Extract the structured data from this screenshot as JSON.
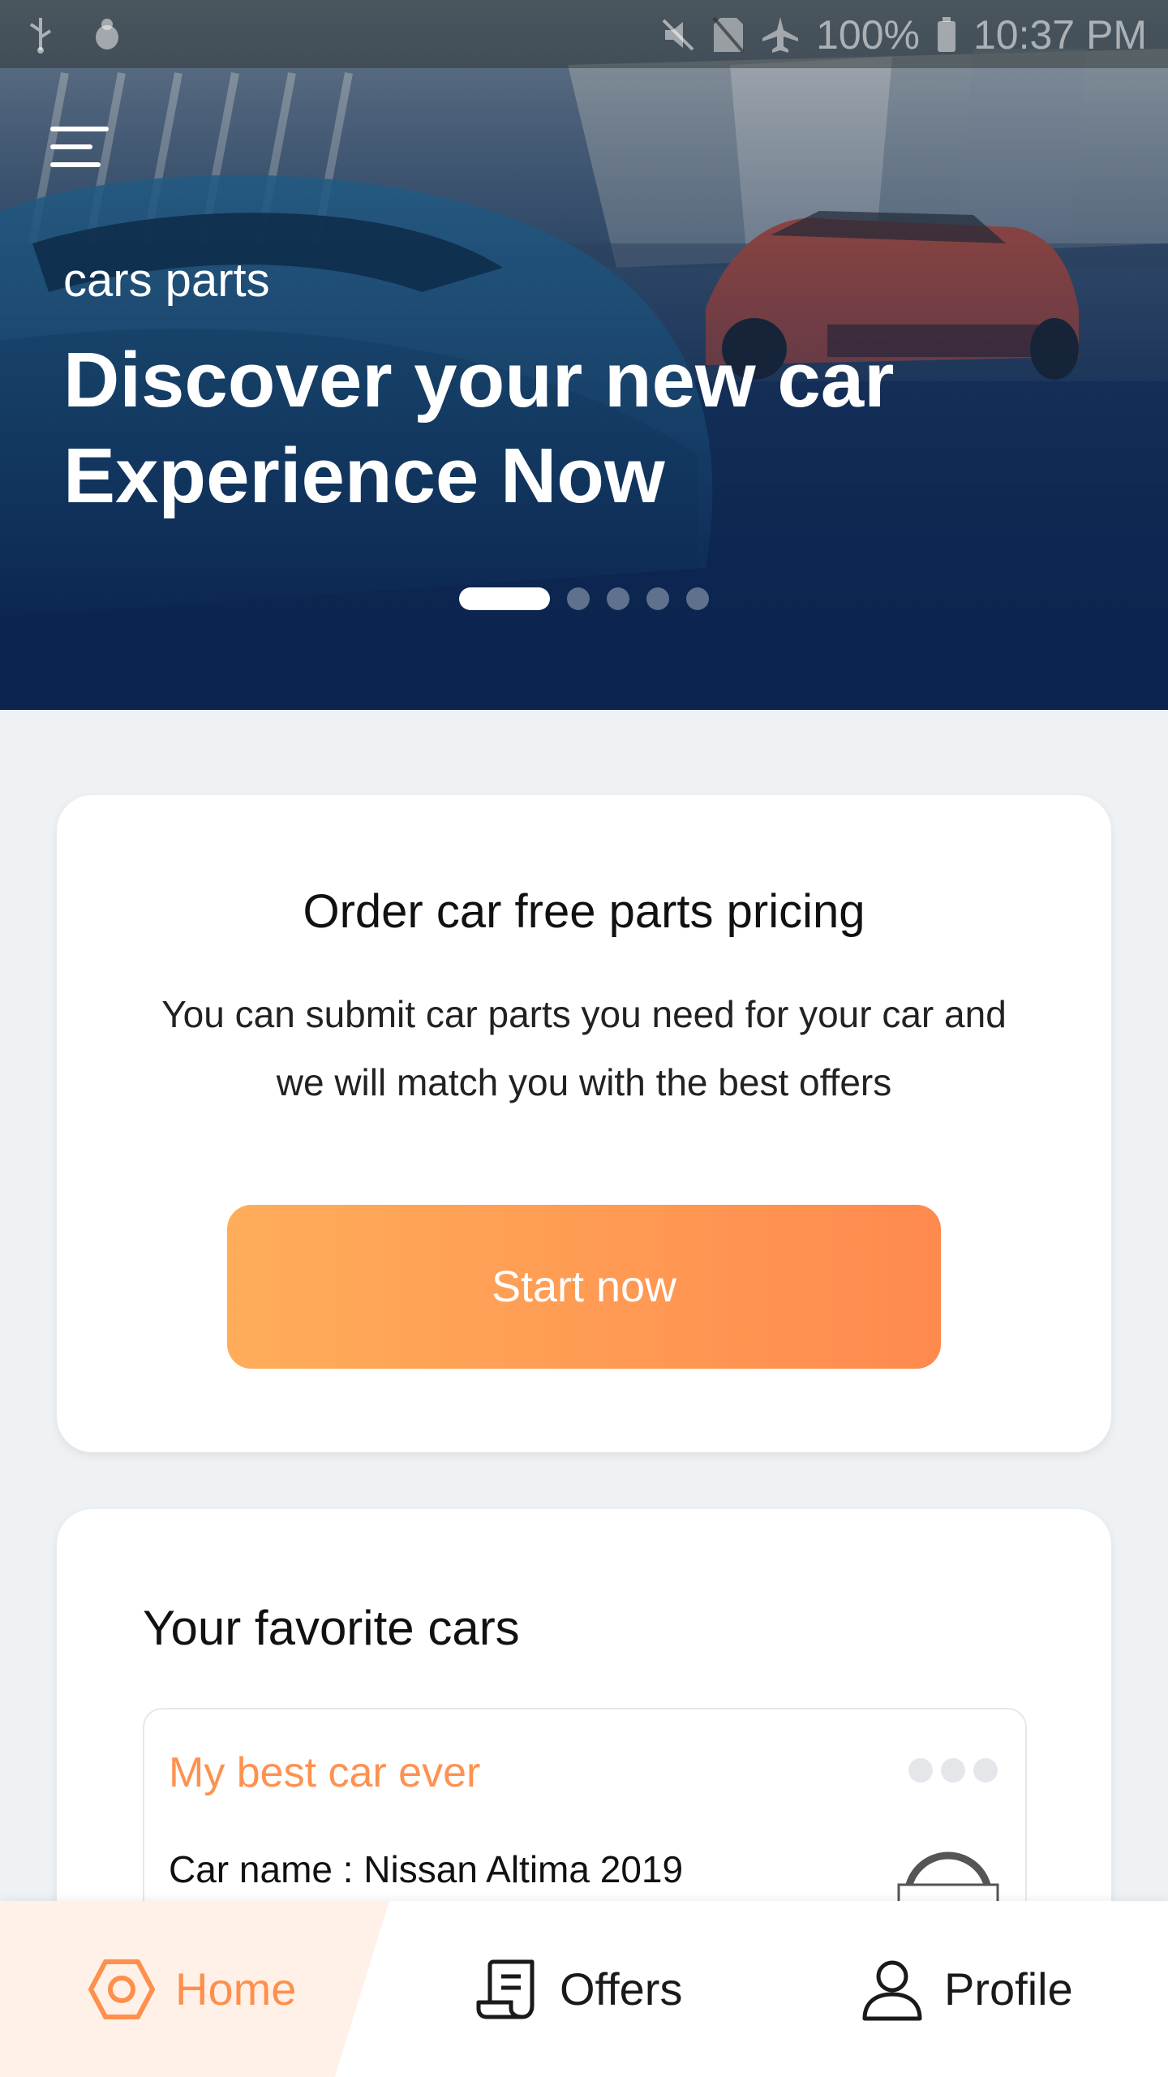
{
  "status_bar": {
    "left_icons": [
      "usb-icon",
      "debug-icon"
    ],
    "right_icons": [
      "mute-icon",
      "no-sim-icon",
      "airplane-icon"
    ],
    "battery": "100%",
    "time": "10:37 PM"
  },
  "hero": {
    "kicker": "cars parts",
    "title": "Discover your new car Experience Now",
    "slides_total": 5,
    "active_slide": 1
  },
  "order_card": {
    "title": "Order car free parts pricing",
    "description": "You can submit car parts you need for your car and we will match you with the best offers",
    "button_label": "Start now"
  },
  "favorites": {
    "title": "Your favorite cars",
    "items": [
      {
        "nickname": "My best car ever",
        "name_line": "Car name : Nissan Altima 2019",
        "logo": "NISSAN"
      }
    ]
  },
  "bottom_nav": {
    "items": [
      {
        "label": "Home",
        "icon": "home-hexagon-icon",
        "active": true
      },
      {
        "label": "Offers",
        "icon": "receipt-icon",
        "active": false
      },
      {
        "label": "Profile",
        "icon": "user-icon",
        "active": false
      }
    ],
    "accent": "#ff8f4d"
  },
  "colors": {
    "primary_gradient_start": "#ffad5a",
    "primary_gradient_end": "#ff8a4e",
    "hero_dark": "#0b2550",
    "background": "#eff2f5"
  }
}
